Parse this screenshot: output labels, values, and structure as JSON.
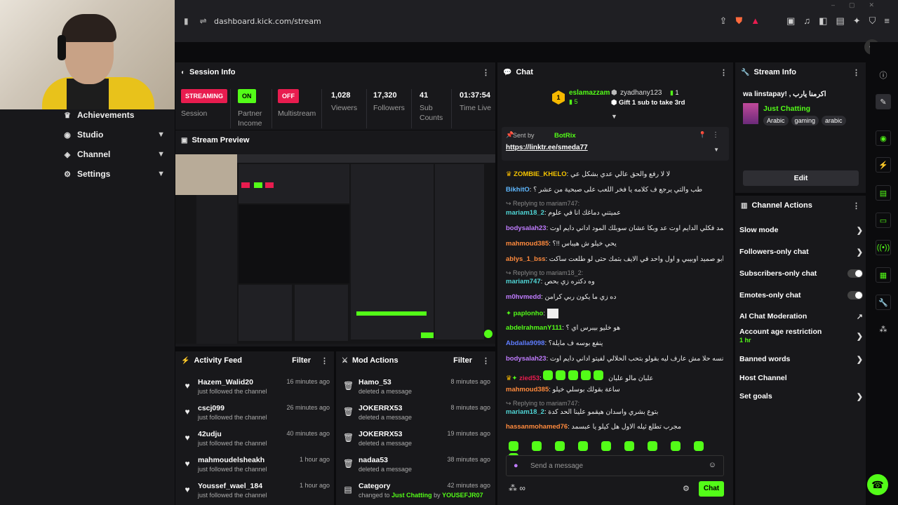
{
  "browser": {
    "url": "dashboard.kick.com/stream"
  },
  "sidebar": {
    "items": [
      {
        "label": "Achievements",
        "icon": "trophy-icon"
      },
      {
        "label": "Studio",
        "icon": "camera-icon"
      },
      {
        "label": "Channel",
        "icon": "channel-icon"
      },
      {
        "label": "Settings",
        "icon": "gear-icon"
      }
    ]
  },
  "session": {
    "title": "Session Info",
    "streaming_badge": "STREAMING",
    "streaming_label": "Session",
    "partner_badge": "ON",
    "partner_label": "Partner Income",
    "multistream_badge": "OFF",
    "multistream_label": "Multistream",
    "stats": [
      {
        "value": "1,028",
        "label": "Viewers"
      },
      {
        "value": "17,320",
        "label": "Followers"
      },
      {
        "value": "41",
        "label": "Sub Counts"
      },
      {
        "value": "01:37:54",
        "label": "Time Live"
      }
    ]
  },
  "preview": {
    "title": "Stream Preview"
  },
  "activity": {
    "title": "Activity Feed",
    "filter": "Filter",
    "items": [
      {
        "user": "Hazem_Walid20",
        "sub": "just followed the channel",
        "time": "16 minutes ago"
      },
      {
        "user": "cscj099",
        "sub": "just followed the channel",
        "time": "26 minutes ago"
      },
      {
        "user": "42udju",
        "sub": "just followed the channel",
        "time": "40 minutes ago"
      },
      {
        "user": "mahmoudelsheakh",
        "sub": "just followed the channel",
        "time": "1 hour ago"
      },
      {
        "user": "Youssef_wael_184",
        "sub": "just followed the channel",
        "time": "1 hour ago"
      }
    ]
  },
  "mod": {
    "title": "Mod Actions",
    "filter": "Filter",
    "items": [
      {
        "user": "Hamo_53",
        "sub": "deleted a message",
        "time": "8 minutes ago"
      },
      {
        "user": "JOKERRX53",
        "sub": "deleted a message",
        "time": "8 minutes ago"
      },
      {
        "user": "JOKERRX53",
        "sub": "deleted a message",
        "time": "19 minutes ago"
      },
      {
        "user": "nadaa53",
        "sub": "deleted a message",
        "time": "38 minutes ago"
      },
      {
        "user": "Category",
        "sub": "changed to",
        "sub_link": "Just Chatting",
        "sub_by": "by",
        "sub_author": "YOUSEFJR07",
        "time": "42 minutes ago"
      }
    ]
  },
  "chat": {
    "title": "Chat",
    "leader1": {
      "name": "eslamazzam",
      "count": "5"
    },
    "leader2": {
      "name": "zyadhany123",
      "count": "1"
    },
    "gift_text": "Gift 1 sub to take 3rd",
    "pinned_sent_by": "Sent by",
    "pinned_bot": "BotRix",
    "pinned_link": "https://linktr.ee/smeda77",
    "messages": [
      {
        "user": "ZOMBIE_KHELO",
        "color": "#f5c400",
        "text": "لا لا رفع والحق عالي عدي بشكل عي"
      },
      {
        "user": "BikhitO",
        "color": "#5fb8ff",
        "text": "طب والتي يرجع ف كلامه يا فخر اللعب على صبحية من عشر ؟"
      },
      {
        "user": "mariam18_2",
        "color": "#4fd4d4",
        "text": "عميتني دماغك انا في علوم",
        "reply": "Replying to mariam747:"
      },
      {
        "user": "bodysalah23",
        "color": "#c07cff",
        "text": "يا عبدالصمد فكلي الدايم اوت عد وبكا عشان سوبلك المود اداني دايم اوت"
      },
      {
        "user": "mahmoud385",
        "color": "#ff8a3d",
        "text": "يحي خيلو ش هيباس !!؟"
      },
      {
        "user": "ablys_1_bss",
        "color": "#ff8a3d",
        "text": "انت وش يا أبو صميد اوبيبي و اول واحد في الايف بتمك حتى لو طلعت ساكت"
      },
      {
        "user": "mariam747",
        "color": "#4fd4d4",
        "text": "وه دكتره زي بحص",
        "reply": "Replying to mariam18_2:"
      },
      {
        "user": "m0hvmedd",
        "color": "#c07cff",
        "text": "ده زي ما يكون ربي كرامن"
      },
      {
        "user": "paplonho",
        "color": "#53fc18",
        "text": ""
      },
      {
        "user": "abdelrahmanY111",
        "color": "#53fc18",
        "text": "هو خليو بيبرس اي ؟"
      },
      {
        "user": "Abdalla9098",
        "color": "#5f7dff",
        "text": "ينفع بوسه ف مايلة؟"
      },
      {
        "user": "bodysalah23",
        "color": "#c07cff",
        "text": "اه انسه حلا مش عارف ليه بقولو بتحب الحلالي لفيتو اداني دايم اوت"
      },
      {
        "user": "zied53",
        "color": "#e81c4f",
        "text": "علبان مالو علبان"
      },
      {
        "user": "mahmoud385",
        "color": "#ff8a3d",
        "text": "ساعة بقولك بوسلي خيلو"
      },
      {
        "user": "mariam18_2",
        "color": "#4fd4d4",
        "text": "بتوع بشري واسدان هيقمو علينا الحد كدة",
        "reply": "Replying to mariam747:"
      },
      {
        "user": "hassanmohamed76",
        "color": "#ff8a3d",
        "text": "مجرب تطلع ثيله الاول هل كيلو يا عبسمد"
      }
    ],
    "placeholder": "Send a message",
    "send_label": "Chat"
  },
  "stream_info": {
    "title": "Stream Info",
    "stream_title": "wa linstapay! , اكرمنا يارب",
    "category": "Just Chatting",
    "tags": [
      "Arabic",
      "gaming",
      "arabic"
    ],
    "edit_label": "Edit"
  },
  "actions": {
    "title": "Channel Actions",
    "items": [
      {
        "label": "Slow mode",
        "control": "arrow"
      },
      {
        "label": "Followers-only chat",
        "control": "arrow"
      },
      {
        "label": "Subscribers-only chat",
        "control": "toggle"
      },
      {
        "label": "Emotes-only chat",
        "control": "toggle"
      },
      {
        "label": "AI Chat Moderation",
        "control": "external"
      },
      {
        "label": "Account age restriction",
        "sub": "1 hr",
        "control": "arrow"
      },
      {
        "label": "Banned words",
        "control": "arrow"
      },
      {
        "label": "Host Channel",
        "control": "none"
      },
      {
        "label": "Set goals",
        "control": "arrow"
      }
    ]
  },
  "colors": {
    "accent": "#53fc18",
    "danger": "#e81c4f"
  }
}
